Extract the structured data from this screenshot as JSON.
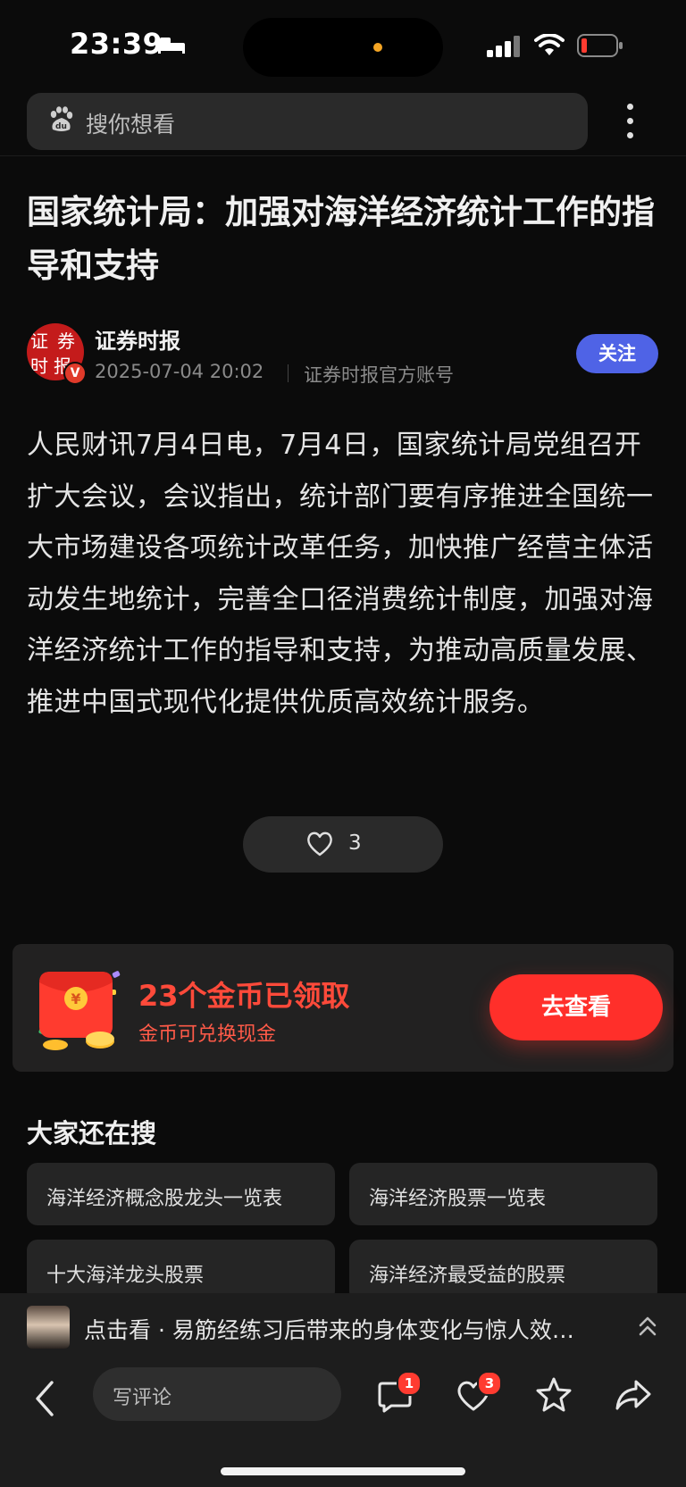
{
  "status_bar": {
    "time": "23:39"
  },
  "search": {
    "placeholder": "搜你想看"
  },
  "article": {
    "title": "国家统计局：加强对海洋经济统计工作的指导和支持",
    "author": "证券时报",
    "date": "2025-07-04 20:02",
    "source": "证券时报官方账号",
    "follow_label": "关注",
    "avatar_chars": [
      "证",
      "券",
      "时",
      "报"
    ],
    "body": "人民财讯7月4日电，7月4日，国家统计局党组召开扩大会议，会议指出，统计部门要有序推进全国统一大市场建设各项统计改革任务，加快推广经营主体活动发生地统计，完善全口径消费统计制度，加强对海洋经济统计工作的指导和支持，为推动高质量发展、推进中国式现代化提供优质高效统计服务。",
    "like_count": "3"
  },
  "coin_card": {
    "title": "23个金币已领取",
    "subtitle": "金币可兑换现金",
    "button": "去查看",
    "envelope_symbol": "¥"
  },
  "related": {
    "heading": "大家还在搜",
    "items": [
      "海洋经济概念股龙头一览表",
      "海洋经济股票一览表",
      "十大海洋龙头股票",
      "海洋经济最受益的股票"
    ]
  },
  "promo": {
    "text": "点击看 · 易筋经练习后带来的身体变化与惊人效…"
  },
  "toolbar": {
    "comment_placeholder": "写评论",
    "comment_badge": "1",
    "like_badge": "3"
  },
  "colors": {
    "background": "#0b0b0b",
    "accent_blue": "#4f63e6",
    "coin_red": "#ff2f2a"
  }
}
